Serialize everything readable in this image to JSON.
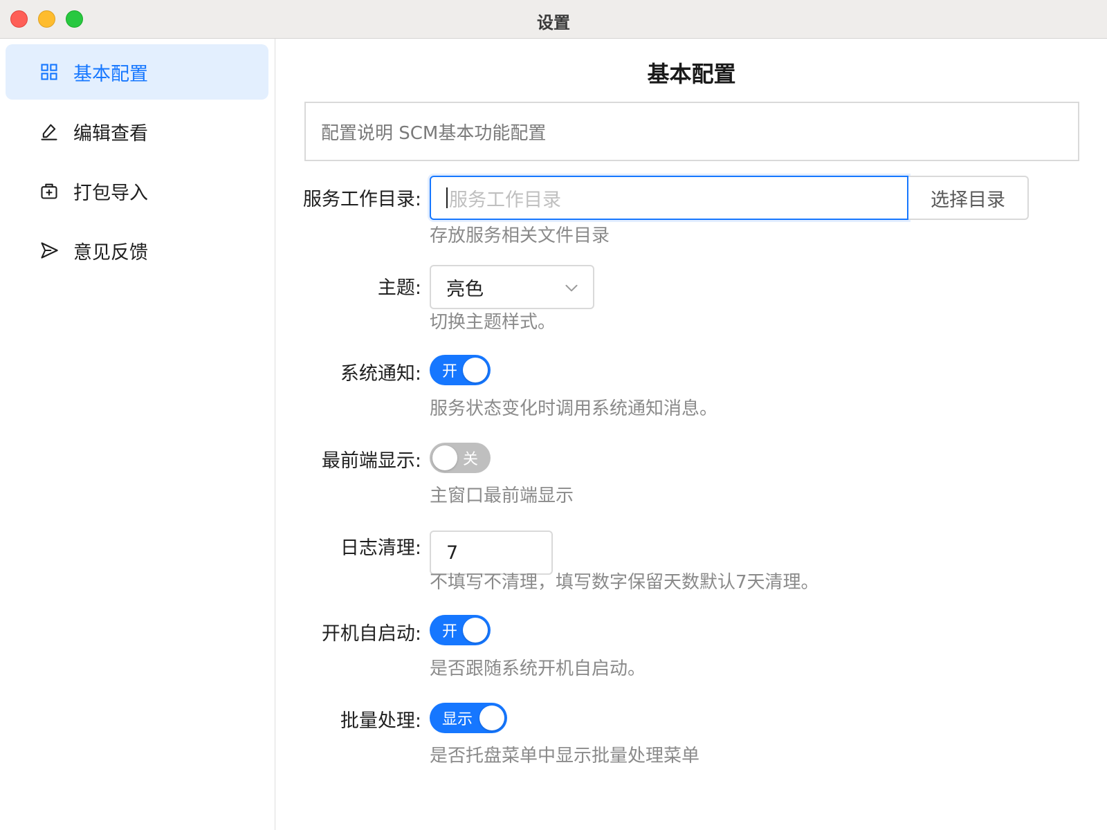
{
  "window": {
    "title": "设置"
  },
  "sidebar": {
    "items": [
      {
        "label": "基本配置",
        "icon": "grid-icon",
        "active": true
      },
      {
        "label": "编辑查看",
        "icon": "edit-icon",
        "active": false
      },
      {
        "label": "打包导入",
        "icon": "package-add-icon",
        "active": false
      },
      {
        "label": "意见反馈",
        "icon": "send-icon",
        "active": false
      }
    ]
  },
  "main": {
    "title": "基本配置",
    "description": "配置说明 SCM基本功能配置",
    "fields": {
      "work_dir": {
        "label": "服务工作目录:",
        "value": "",
        "placeholder": "服务工作目录",
        "button_label": "选择目录",
        "help": "存放服务相关文件目录"
      },
      "theme": {
        "label": "主题:",
        "value": "亮色",
        "help": "切换主题样式。"
      },
      "system_notify": {
        "label": "系统通知:",
        "toggle_text": "开",
        "on": true,
        "help": "服务状态变化时调用系统通知消息。"
      },
      "always_on_top": {
        "label": "最前端显示:",
        "toggle_text": "关",
        "on": false,
        "help": "主窗口最前端显示"
      },
      "log_clean": {
        "label": "日志清理:",
        "value": "7",
        "help": "不填写不清理，填写数字保留天数默认7天清理。"
      },
      "auto_start": {
        "label": "开机自启动:",
        "toggle_text": "开",
        "on": true,
        "help": "是否跟随系统开机自启动。"
      },
      "batch": {
        "label": "批量处理:",
        "toggle_text": "显示",
        "on": true,
        "help": "是否托盘菜单中显示批量处理菜单"
      }
    }
  },
  "colors": {
    "accent": "#1677ff",
    "active_bg": "#e3effe",
    "toggle_off": "#bfbfbf"
  }
}
